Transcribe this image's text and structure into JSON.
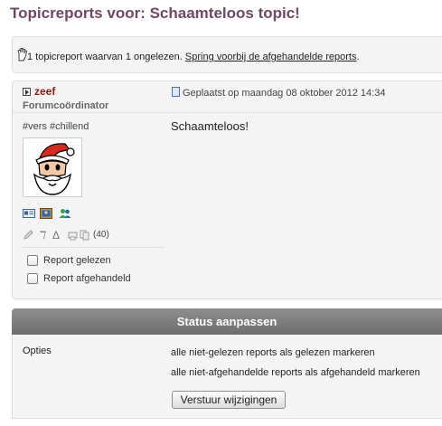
{
  "page": {
    "title": "Topicreports voor: Schaamteloos topic!"
  },
  "info": {
    "text": "1 topicreport waarvan 1 ongelezen.",
    "link": "Spring voorbij de afgehandelde reports",
    "trailing": "."
  },
  "post": {
    "author": "zeef",
    "role": "Forumcoördinator",
    "posted": "Geplaatst op maandag 08 oktober 2012 14:34",
    "tags": "#vers #chillend",
    "body": "Schaamteloos!",
    "glyph_pi": "ℸ",
    "glyph_delta": "Δ",
    "count": "(40)",
    "checkboxes": {
      "read": "Report gelezen",
      "handled": "Report afgehandeld"
    }
  },
  "status": {
    "heading": "Status aanpassen",
    "options_label": "Opties",
    "option1": "alle niet-gelezen reports als gelezen markeren",
    "option2": "alle niet-afgehandelde reports als afgehandeld markeren",
    "submit": "Verstuur wijzigingen"
  },
  "colors": {
    "title": "#6e4963",
    "author": "#8a1d14",
    "status_bar": "#7e7e7e"
  }
}
